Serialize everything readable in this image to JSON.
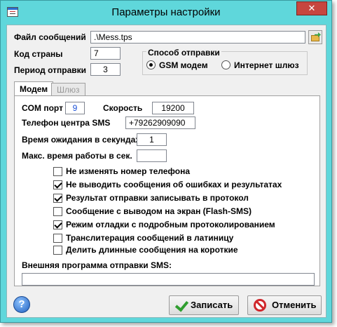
{
  "window": {
    "title": "Параметры настройки",
    "close_label": "✕"
  },
  "file": {
    "label": "Файл сообщений",
    "value": ".\\Mess.tps"
  },
  "country": {
    "label": "Код страны",
    "value": "7"
  },
  "period": {
    "label": "Период отправки",
    "value": "3"
  },
  "send_method": {
    "label": "Способ отправки",
    "options": [
      {
        "label": "GSM модем",
        "checked": true
      },
      {
        "label": "Интернет шлюз",
        "checked": false
      }
    ]
  },
  "tabs": [
    {
      "label": "Модем",
      "active": true
    },
    {
      "label": "Шлюз",
      "active": false
    }
  ],
  "modem": {
    "com_port_label": "COM порт",
    "com_port_value": "9",
    "speed_label": "Скорость",
    "speed_value": "19200",
    "sms_center_label": "Телефон центра SMS",
    "sms_center_value": "+79262909090",
    "wait_label": "Время ожидания в секундах",
    "wait_value": "1",
    "max_work_label": "Макс. время работы в сек.",
    "max_work_value": ""
  },
  "options": [
    {
      "label": "Не изменять номер телефона",
      "checked": false
    },
    {
      "label": "Не выводить сообщения об ошибках и результатах",
      "checked": true
    },
    {
      "label": "Результат отправки записывать в протокол",
      "checked": true
    },
    {
      "label": "Сообщение с выводом на экран (Flash-SMS)",
      "checked": false
    },
    {
      "label": "Режим отладки с подробным протоколированием",
      "checked": true
    },
    {
      "label": "Транслитерация сообщений в латиницу",
      "checked": false
    },
    {
      "label": "Делить длинные сообщения на короткие",
      "checked": false
    }
  ],
  "external": {
    "label": "Внешняя программа отправки SMS:",
    "value": ""
  },
  "buttons": {
    "help": "?",
    "save": "Записать",
    "cancel": "Отменить"
  }
}
